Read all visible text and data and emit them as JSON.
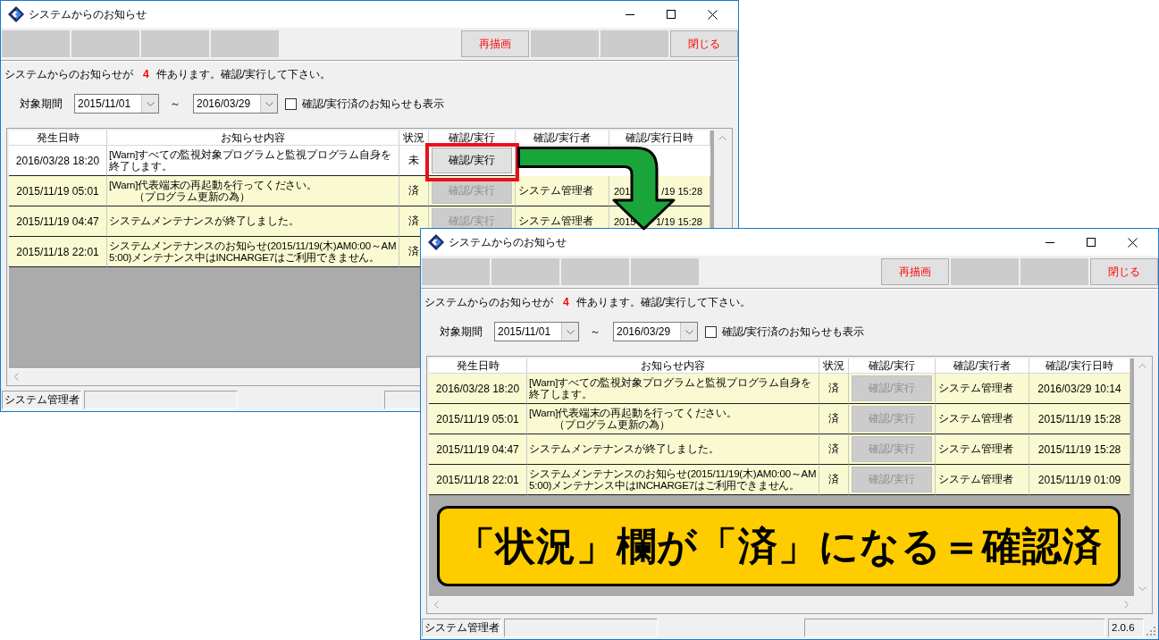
{
  "windows": [
    {
      "title": "システムからのお知らせ",
      "toolbar": {
        "left": [
          {
            "kind": "blank"
          },
          {
            "kind": "blank"
          },
          {
            "kind": "blank"
          },
          {
            "kind": "blank"
          }
        ],
        "right": [
          {
            "kind": "button",
            "label": "再描画"
          },
          {
            "kind": "blank"
          },
          {
            "kind": "blank"
          },
          {
            "kind": "button",
            "label": "閉じる"
          }
        ]
      },
      "notice": {
        "prefix": "システムからのお知らせが",
        "count": "4",
        "suffix": "件あります。確認/実行して下さい。"
      },
      "filter": {
        "label": "対象期間",
        "from": "2015/11/01",
        "separator": "～",
        "to": "2016/03/29",
        "show_done": {
          "label": "確認/実行済のお知らせも表示",
          "checked": false
        }
      },
      "table": {
        "columns": [
          "発生日時",
          "お知らせ内容",
          "状況",
          "確認/実行",
          "確認/実行者",
          "確認/実行日時"
        ],
        "rows": [
          {
            "occurred_at": "2016/03/28 18:20",
            "message": "[Warn]すべての監視対象プログラムと監視プログラム自身を終了します。",
            "status": "未",
            "button": "確認/実行",
            "done": false,
            "highlighted": true
          },
          {
            "occurred_at": "2015/11/19 05:01",
            "message": [
              "[Warn]代表端末の再起動を行ってください。",
              "（プログラム更新の為）"
            ],
            "status": "済",
            "button": "確認/実行",
            "done": true,
            "highlighted": false,
            "executor": "システム管理者",
            "confirmed_at": [
              "201",
              "/19 15:28"
            ]
          },
          {
            "occurred_at": "2015/11/19 04:47",
            "message": "システムメンテナンスが終了しました。",
            "status": "済",
            "button": "確認/実行",
            "done": true,
            "highlighted": false,
            "executor": "システム管理者",
            "confirmed_at": [
              "2015",
              "1/19 15:28"
            ]
          },
          {
            "occurred_at": "2015/11/18 22:01",
            "message": "システムメンテナンスのお知らせ(2015/11/19(木)AM0:00～AM5:00)メンテナンス中はINCHARGE7はご利用できません。",
            "status": "済",
            "done": true
          }
        ]
      },
      "status_bar": {
        "user": "システム管理者"
      }
    },
    {
      "title": "システムからのお知らせ",
      "toolbar": {
        "left": [
          {
            "kind": "blank"
          },
          {
            "kind": "blank"
          },
          {
            "kind": "blank"
          },
          {
            "kind": "blank"
          }
        ],
        "right": [
          {
            "kind": "button",
            "label": "再描画"
          },
          {
            "kind": "blank"
          },
          {
            "kind": "blank"
          },
          {
            "kind": "button",
            "label": "閉じる"
          }
        ]
      },
      "notice": {
        "prefix": "システムからのお知らせが",
        "count": "4",
        "suffix": "件あります。確認/実行して下さい。"
      },
      "filter": {
        "label": "対象期間",
        "from": "2015/11/01",
        "separator": "～",
        "to": "2016/03/29",
        "show_done": {
          "label": "確認/実行済のお知らせも表示",
          "checked": false
        }
      },
      "table": {
        "columns": [
          "発生日時",
          "お知らせ内容",
          "状況",
          "確認/実行",
          "確認/実行者",
          "確認/実行日時"
        ],
        "rows": [
          {
            "occurred_at": "2016/03/28 18:20",
            "message": "[Warn]すべての監視対象プログラムと監視プログラム自身を終了します。",
            "status": "済",
            "button": "確認/実行",
            "done": true,
            "highlighted": false,
            "executor": "システム管理者",
            "confirmed_at": "2016/03/29 10:14"
          },
          {
            "occurred_at": "2015/11/19 05:01",
            "message": [
              "[Warn]代表端末の再起動を行ってください。",
              "（プログラム更新の為）"
            ],
            "status": "済",
            "button": "確認/実行",
            "done": true,
            "highlighted": false,
            "executor": "システム管理者",
            "confirmed_at": "2015/11/19 15:28"
          },
          {
            "occurred_at": "2015/11/19 04:47",
            "message": "システムメンテナンスが終了しました。",
            "status": "済",
            "button": "確認/実行",
            "done": true,
            "highlighted": false,
            "executor": "システム管理者",
            "confirmed_at": "2015/11/19 15:28"
          },
          {
            "occurred_at": "2015/11/18 22:01",
            "message": "システムメンテナンスのお知らせ(2015/11/19(木)AM0:00～AM5:00)メンテナンス中はINCHARGE7はご利用できません。",
            "status": "済",
            "button": "確認/実行",
            "done": true,
            "highlighted": false,
            "executor": "システム管理者",
            "confirmed_at": "2015/11/19 01:09"
          }
        ]
      },
      "status_bar": {
        "user": "システム管理者",
        "version": "2.0.6"
      }
    }
  ],
  "callout": {
    "text": "「状況」欄が「済」になる＝確認済"
  }
}
